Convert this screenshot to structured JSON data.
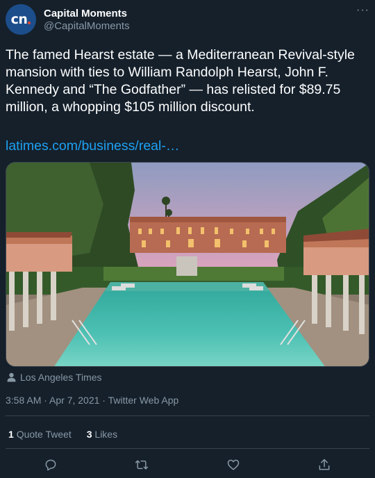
{
  "account": {
    "avatar_text": "cn",
    "name": "Capital Moments",
    "handle": "@CapitalMoments"
  },
  "menu_glyph": "···",
  "tweet": {
    "text": "The famed Hearst estate — a Mediterranean Revival-style mansion with ties to William Randolph Hearst, John F. Kennedy and “The Godfather” — has relisted for $89.75 million, a whopping $105 million discount.",
    "link": "latimes.com/business/real-…"
  },
  "media": {
    "description_icon": "mansion-with-pool-photo",
    "source": "Los Angeles Times"
  },
  "meta": {
    "timestamp": "3:58 AM · Apr 7, 2021 · Twitter Web App"
  },
  "stats": {
    "quote_count": "1",
    "quote_label": "Quote Tweet",
    "like_count": "3",
    "like_label": "Likes"
  },
  "actions": [
    "reply-icon",
    "retweet-icon",
    "like-icon",
    "share-icon"
  ],
  "colors": {
    "background": "#15202b",
    "text": "#ffffff",
    "secondary": "#8899a6",
    "link": "#1da1f2",
    "divider": "#38444d",
    "avatar": "#1c4e8c"
  }
}
